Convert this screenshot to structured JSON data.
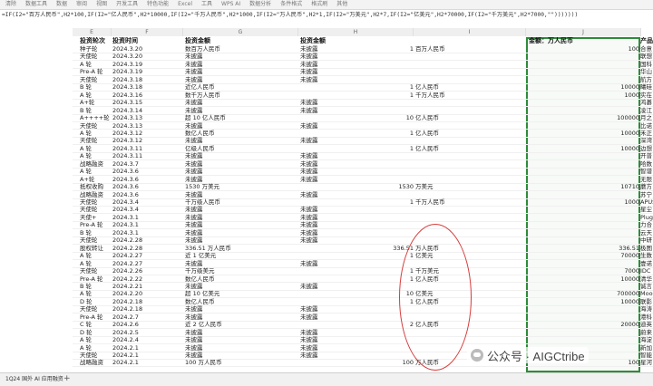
{
  "toolbar": {
    "items": [
      "清除",
      "数据工具",
      "数据",
      "审阅",
      "视图",
      "开发工具",
      "特色功能",
      "Excel",
      "工具",
      "WPS AI",
      "数据分析",
      "条件格式",
      "格式刷",
      "其他"
    ]
  },
  "formula_bar": {
    "text": "=IF(I2=\"百万人民币\",H2*100,IF(I2=\"亿人民币\",H2*10000,IF(I2=\"千万人民币\",H2*1000,IF(I2=\"万人民币\",H2*1,IF(I2=\"万美元\",H2*7,IF(I2=\"亿美元\",H2*70000,IF(I2=\"千万美元\",H2*7000,\"\")))))))"
  },
  "column_letters": [
    "E",
    "F",
    "G",
    "H",
    "I",
    "J"
  ],
  "headers": {
    "round": "投资轮次",
    "time": "投资时间",
    "amount_text": "投资金额",
    "amount": "投资金额",
    "converted": "金额：万人民币",
    "extra": "产品"
  },
  "rows": [
    {
      "round": "种子轮",
      "time": "2024.3.20",
      "text": "数百万人民币",
      "amt": "未披露",
      "num": "1",
      "unit": "百万人民币",
      "conv": "100",
      "x": "合意"
    },
    {
      "round": "天使轮",
      "time": "2024.3.20",
      "text": "未披露",
      "amt": "未披露",
      "num": "",
      "unit": "",
      "conv": "",
      "x": "联想"
    },
    {
      "round": "A 轮",
      "time": "2024.3.19",
      "text": "未披露",
      "amt": "未披露",
      "num": "",
      "unit": "",
      "conv": "",
      "x": "国科"
    },
    {
      "round": "Pre-A 轮",
      "time": "2024.3.19",
      "text": "未披露",
      "amt": "未披露",
      "num": "",
      "unit": "",
      "conv": "",
      "x": "华山"
    },
    {
      "round": "天使轮",
      "time": "2024.3.18",
      "text": "未披露",
      "amt": "未披露",
      "num": "",
      "unit": "",
      "conv": "",
      "x": "航方"
    },
    {
      "round": "B 轮",
      "time": "2024.3.18",
      "text": "近亿人民币",
      "amt": "",
      "num": "1",
      "unit": "亿人民币",
      "conv": "10000",
      "x": "曦硅"
    },
    {
      "round": "A 轮",
      "time": "2024.3.16",
      "text": "数千万人民币",
      "amt": "",
      "num": "1",
      "unit": "千万人民币",
      "conv": "1000",
      "x": "实在"
    },
    {
      "round": "A+轮",
      "time": "2024.3.15",
      "text": "未披露",
      "amt": "未披露",
      "num": "",
      "unit": "",
      "conv": "",
      "x": "鸿碁"
    },
    {
      "round": "B 轮",
      "time": "2024.3.14",
      "text": "未披露",
      "amt": "未披露",
      "num": "",
      "unit": "",
      "conv": "",
      "x": "凌江"
    },
    {
      "round": "A++++轮",
      "time": "2024.3.13",
      "text": "超 10 亿人民币",
      "amt": "",
      "num": "10",
      "unit": "亿人民币",
      "conv": "100000",
      "x": "月之"
    },
    {
      "round": "天使轮",
      "time": "2024.3.13",
      "text": "未披露",
      "amt": "未披露",
      "num": "",
      "unit": "",
      "conv": "",
      "x": "比诺"
    },
    {
      "round": "A 轮",
      "time": "2024.3.12",
      "text": "数亿人民币",
      "amt": "",
      "num": "1",
      "unit": "亿人民币",
      "conv": "10000",
      "x": "禾正"
    },
    {
      "round": "天使轮",
      "time": "2024.3.12",
      "text": "未披露",
      "amt": "未披露",
      "num": "",
      "unit": "",
      "conv": "",
      "x": "深湾"
    },
    {
      "round": "A 轮",
      "time": "2024.3.11",
      "text": "亿级人民币",
      "amt": "",
      "num": "1",
      "unit": "亿人民币",
      "conv": "10000",
      "x": "边想"
    },
    {
      "round": "A 轮",
      "time": "2024.3.11",
      "text": "未披露",
      "amt": "未披露",
      "num": "",
      "unit": "",
      "conv": "",
      "x": "开普"
    },
    {
      "round": "战略融资",
      "time": "2024.3.7",
      "text": "未披露",
      "amt": "未披露",
      "num": "",
      "unit": "",
      "conv": "",
      "x": "哈数"
    },
    {
      "round": "A 轮",
      "time": "2024.3.6",
      "text": "未披露",
      "amt": "未披露",
      "num": "",
      "unit": "",
      "conv": "",
      "x": "智谱"
    },
    {
      "round": "A+轮",
      "time": "2024.3.6",
      "text": "未披露",
      "amt": "未披露",
      "num": "",
      "unit": "",
      "conv": "",
      "x": "无限"
    },
    {
      "round": "抵权收购",
      "time": "2024.3.6",
      "text": "1530 万美元",
      "amt": "",
      "num": "1530",
      "unit": "万美元",
      "conv": "10710",
      "x": "蘑方"
    },
    {
      "round": "战略融资",
      "time": "2024.3.6",
      "text": "未披露",
      "amt": "未披露",
      "num": "",
      "unit": "",
      "conv": "",
      "x": "苏宁"
    },
    {
      "round": "天使轮",
      "time": "2024.3.4",
      "text": "千万级人民币",
      "amt": "",
      "num": "1",
      "unit": "千万人民币",
      "conv": "1000",
      "x": "APUS"
    },
    {
      "round": "天使轮",
      "time": "2024.3.4",
      "text": "未披露",
      "amt": "未披露",
      "num": "",
      "unit": "",
      "conv": "",
      "x": "星尘"
    },
    {
      "round": "天使+",
      "time": "2024.3.1",
      "text": "未披露",
      "amt": "未披露",
      "num": "",
      "unit": "",
      "conv": "",
      "x": "Plug"
    },
    {
      "round": "Pre-A 轮",
      "time": "2024.3.1",
      "text": "未披露",
      "amt": "未披露",
      "num": "",
      "unit": "",
      "conv": "",
      "x": "力合"
    },
    {
      "round": "B 轮",
      "time": "2024.3.1",
      "text": "未披露",
      "amt": "未披露",
      "num": "",
      "unit": "",
      "conv": "",
      "x": "云天"
    },
    {
      "round": "天使轮",
      "time": "2024.2.28",
      "text": "未披露",
      "amt": "未披露",
      "num": "",
      "unit": "",
      "conv": "",
      "x": "中研"
    },
    {
      "round": "股权转让",
      "time": "2024.2.28",
      "text": "336.51 万人民币",
      "amt": "",
      "num": "336.51",
      "unit": "万人民币",
      "conv": "336.51",
      "x": "极图"
    },
    {
      "round": "A 轮",
      "time": "2024.2.27",
      "text": "近 1 亿美元",
      "amt": "",
      "num": "1",
      "unit": "亿美元",
      "conv": "70000",
      "x": "生数"
    },
    {
      "round": "A 轮",
      "time": "2024.2.27",
      "text": "未披露",
      "amt": "未披露",
      "num": "",
      "unit": "",
      "conv": "",
      "x": "壹诺"
    },
    {
      "round": "天使轮",
      "time": "2024.2.26",
      "text": "千万级美元",
      "amt": "",
      "num": "1",
      "unit": "千万美元",
      "conv": "7000",
      "x": "IDC"
    },
    {
      "round": "Pre-A 轮",
      "time": "2024.2.22",
      "text": "数亿人民币",
      "amt": "",
      "num": "1",
      "unit": "亿人民币",
      "conv": "10000",
      "x": "清华"
    },
    {
      "round": "B 轮",
      "time": "2024.2.21",
      "text": "未披露",
      "amt": "未披露",
      "num": "",
      "unit": "",
      "conv": "",
      "x": "诚言"
    },
    {
      "round": "A 轮",
      "time": "2024.2.20",
      "text": "超 10 亿美元",
      "amt": "",
      "num": "10",
      "unit": "亿美元",
      "conv": "700000",
      "x": "Moon"
    },
    {
      "round": "D 轮",
      "time": "2024.2.18",
      "text": "数亿人民币",
      "amt": "",
      "num": "1",
      "unit": "亿人民币",
      "conv": "10000",
      "x": "联影"
    },
    {
      "round": "天使轮",
      "time": "2024.2.18",
      "text": "未披露",
      "amt": "未披露",
      "num": "",
      "unit": "",
      "conv": "",
      "x": "海涛"
    },
    {
      "round": "Pre-A 轮",
      "time": "2024.2.7",
      "text": "未披露",
      "amt": "未披露",
      "num": "",
      "unit": "",
      "conv": "",
      "x": "港科"
    },
    {
      "round": "C 轮",
      "time": "2024.2.6",
      "text": "近 2 亿人民币",
      "amt": "",
      "num": "2",
      "unit": "亿人民币",
      "conv": "20000",
      "x": "迪英"
    },
    {
      "round": "D 轮",
      "time": "2024.2.5",
      "text": "未披露",
      "amt": "未披露",
      "num": "",
      "unit": "",
      "conv": "",
      "x": "蔚来"
    },
    {
      "round": "A 轮",
      "time": "2024.2.4",
      "text": "未披露",
      "amt": "未披露",
      "num": "",
      "unit": "",
      "conv": "",
      "x": "海淀"
    },
    {
      "round": "A 轮",
      "time": "2024.2.1",
      "text": "未披露",
      "amt": "未披露",
      "num": "",
      "unit": "",
      "conv": "",
      "x": "新加"
    },
    {
      "round": "天使轮",
      "time": "2024.2.1",
      "text": "未披露",
      "amt": "未披露",
      "num": "",
      "unit": "",
      "conv": "",
      "x": "智能"
    },
    {
      "round": "战略融资",
      "time": "2024.2.1",
      "text": "100 万人民币",
      "amt": "",
      "num": "100",
      "unit": "万人民币",
      "conv": "100",
      "x": "星河"
    }
  ],
  "sheet_tab": "1Q24 国外 AI 应用融资",
  "add_tab": "+",
  "watermark": "公众号 · AIGCtribe",
  "colors": {
    "selection": "#2e8b3a",
    "annotation_circle": "#d63b3b"
  }
}
